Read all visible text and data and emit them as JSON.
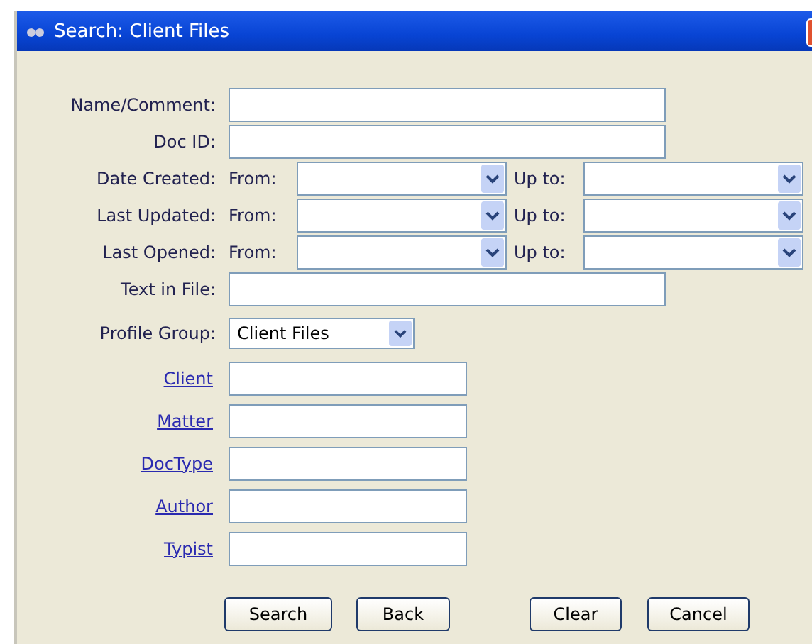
{
  "window": {
    "title": "Search: Client Files"
  },
  "fields": [
    {
      "kind": "text",
      "label": "Name/Comment:"
    },
    {
      "kind": "text",
      "label": "Doc ID:"
    },
    {
      "kind": "date_range",
      "label": "Date Created:",
      "from_label": "From:",
      "to_label": "Up to:"
    },
    {
      "kind": "date_range",
      "label": "Last Updated:",
      "from_label": "From:",
      "to_label": "Up to:"
    },
    {
      "kind": "date_range",
      "label": "Last Opened:",
      "from_label": "From:",
      "to_label": "Up to:"
    },
    {
      "kind": "text",
      "label": "Text in File:"
    },
    {
      "kind": "select",
      "label": "Profile Group:",
      "value": "Client Files"
    },
    {
      "kind": "link",
      "label": "Client"
    },
    {
      "kind": "link",
      "label": "Matter"
    },
    {
      "kind": "link",
      "label": "DocType"
    },
    {
      "kind": "link",
      "label": "Author"
    },
    {
      "kind": "link",
      "label": "Typist"
    }
  ],
  "buttons": [
    "Search",
    "Back",
    "Clear",
    "Cancel"
  ]
}
